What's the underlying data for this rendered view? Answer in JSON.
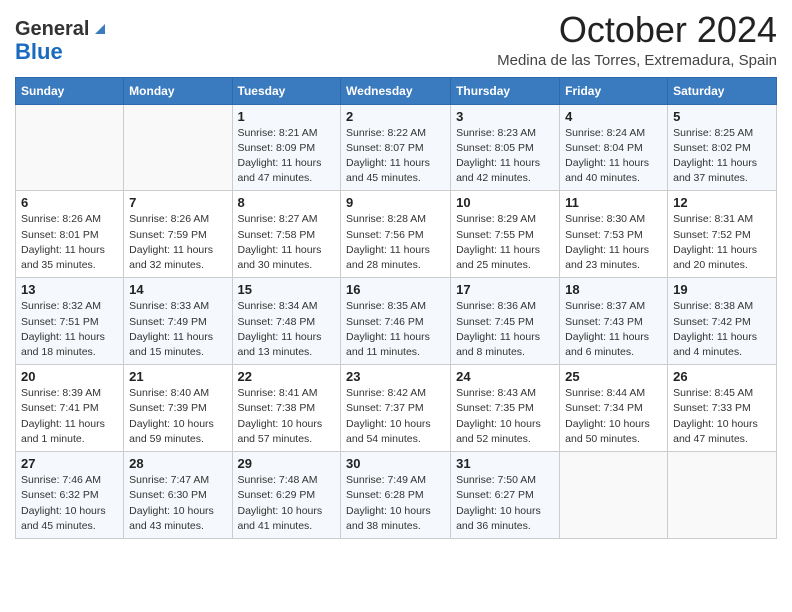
{
  "header": {
    "logo_general": "General",
    "logo_blue": "Blue",
    "month_title": "October 2024",
    "location": "Medina de las Torres, Extremadura, Spain"
  },
  "weekdays": [
    "Sunday",
    "Monday",
    "Tuesday",
    "Wednesday",
    "Thursday",
    "Friday",
    "Saturday"
  ],
  "weeks": [
    [
      {
        "day": "",
        "info": ""
      },
      {
        "day": "",
        "info": ""
      },
      {
        "day": "1",
        "info": "Sunrise: 8:21 AM\nSunset: 8:09 PM\nDaylight: 11 hours and 47 minutes."
      },
      {
        "day": "2",
        "info": "Sunrise: 8:22 AM\nSunset: 8:07 PM\nDaylight: 11 hours and 45 minutes."
      },
      {
        "day": "3",
        "info": "Sunrise: 8:23 AM\nSunset: 8:05 PM\nDaylight: 11 hours and 42 minutes."
      },
      {
        "day": "4",
        "info": "Sunrise: 8:24 AM\nSunset: 8:04 PM\nDaylight: 11 hours and 40 minutes."
      },
      {
        "day": "5",
        "info": "Sunrise: 8:25 AM\nSunset: 8:02 PM\nDaylight: 11 hours and 37 minutes."
      }
    ],
    [
      {
        "day": "6",
        "info": "Sunrise: 8:26 AM\nSunset: 8:01 PM\nDaylight: 11 hours and 35 minutes."
      },
      {
        "day": "7",
        "info": "Sunrise: 8:26 AM\nSunset: 7:59 PM\nDaylight: 11 hours and 32 minutes."
      },
      {
        "day": "8",
        "info": "Sunrise: 8:27 AM\nSunset: 7:58 PM\nDaylight: 11 hours and 30 minutes."
      },
      {
        "day": "9",
        "info": "Sunrise: 8:28 AM\nSunset: 7:56 PM\nDaylight: 11 hours and 28 minutes."
      },
      {
        "day": "10",
        "info": "Sunrise: 8:29 AM\nSunset: 7:55 PM\nDaylight: 11 hours and 25 minutes."
      },
      {
        "day": "11",
        "info": "Sunrise: 8:30 AM\nSunset: 7:53 PM\nDaylight: 11 hours and 23 minutes."
      },
      {
        "day": "12",
        "info": "Sunrise: 8:31 AM\nSunset: 7:52 PM\nDaylight: 11 hours and 20 minutes."
      }
    ],
    [
      {
        "day": "13",
        "info": "Sunrise: 8:32 AM\nSunset: 7:51 PM\nDaylight: 11 hours and 18 minutes."
      },
      {
        "day": "14",
        "info": "Sunrise: 8:33 AM\nSunset: 7:49 PM\nDaylight: 11 hours and 15 minutes."
      },
      {
        "day": "15",
        "info": "Sunrise: 8:34 AM\nSunset: 7:48 PM\nDaylight: 11 hours and 13 minutes."
      },
      {
        "day": "16",
        "info": "Sunrise: 8:35 AM\nSunset: 7:46 PM\nDaylight: 11 hours and 11 minutes."
      },
      {
        "day": "17",
        "info": "Sunrise: 8:36 AM\nSunset: 7:45 PM\nDaylight: 11 hours and 8 minutes."
      },
      {
        "day": "18",
        "info": "Sunrise: 8:37 AM\nSunset: 7:43 PM\nDaylight: 11 hours and 6 minutes."
      },
      {
        "day": "19",
        "info": "Sunrise: 8:38 AM\nSunset: 7:42 PM\nDaylight: 11 hours and 4 minutes."
      }
    ],
    [
      {
        "day": "20",
        "info": "Sunrise: 8:39 AM\nSunset: 7:41 PM\nDaylight: 11 hours and 1 minute."
      },
      {
        "day": "21",
        "info": "Sunrise: 8:40 AM\nSunset: 7:39 PM\nDaylight: 10 hours and 59 minutes."
      },
      {
        "day": "22",
        "info": "Sunrise: 8:41 AM\nSunset: 7:38 PM\nDaylight: 10 hours and 57 minutes."
      },
      {
        "day": "23",
        "info": "Sunrise: 8:42 AM\nSunset: 7:37 PM\nDaylight: 10 hours and 54 minutes."
      },
      {
        "day": "24",
        "info": "Sunrise: 8:43 AM\nSunset: 7:35 PM\nDaylight: 10 hours and 52 minutes."
      },
      {
        "day": "25",
        "info": "Sunrise: 8:44 AM\nSunset: 7:34 PM\nDaylight: 10 hours and 50 minutes."
      },
      {
        "day": "26",
        "info": "Sunrise: 8:45 AM\nSunset: 7:33 PM\nDaylight: 10 hours and 47 minutes."
      }
    ],
    [
      {
        "day": "27",
        "info": "Sunrise: 7:46 AM\nSunset: 6:32 PM\nDaylight: 10 hours and 45 minutes."
      },
      {
        "day": "28",
        "info": "Sunrise: 7:47 AM\nSunset: 6:30 PM\nDaylight: 10 hours and 43 minutes."
      },
      {
        "day": "29",
        "info": "Sunrise: 7:48 AM\nSunset: 6:29 PM\nDaylight: 10 hours and 41 minutes."
      },
      {
        "day": "30",
        "info": "Sunrise: 7:49 AM\nSunset: 6:28 PM\nDaylight: 10 hours and 38 minutes."
      },
      {
        "day": "31",
        "info": "Sunrise: 7:50 AM\nSunset: 6:27 PM\nDaylight: 10 hours and 36 minutes."
      },
      {
        "day": "",
        "info": ""
      },
      {
        "day": "",
        "info": ""
      }
    ]
  ]
}
